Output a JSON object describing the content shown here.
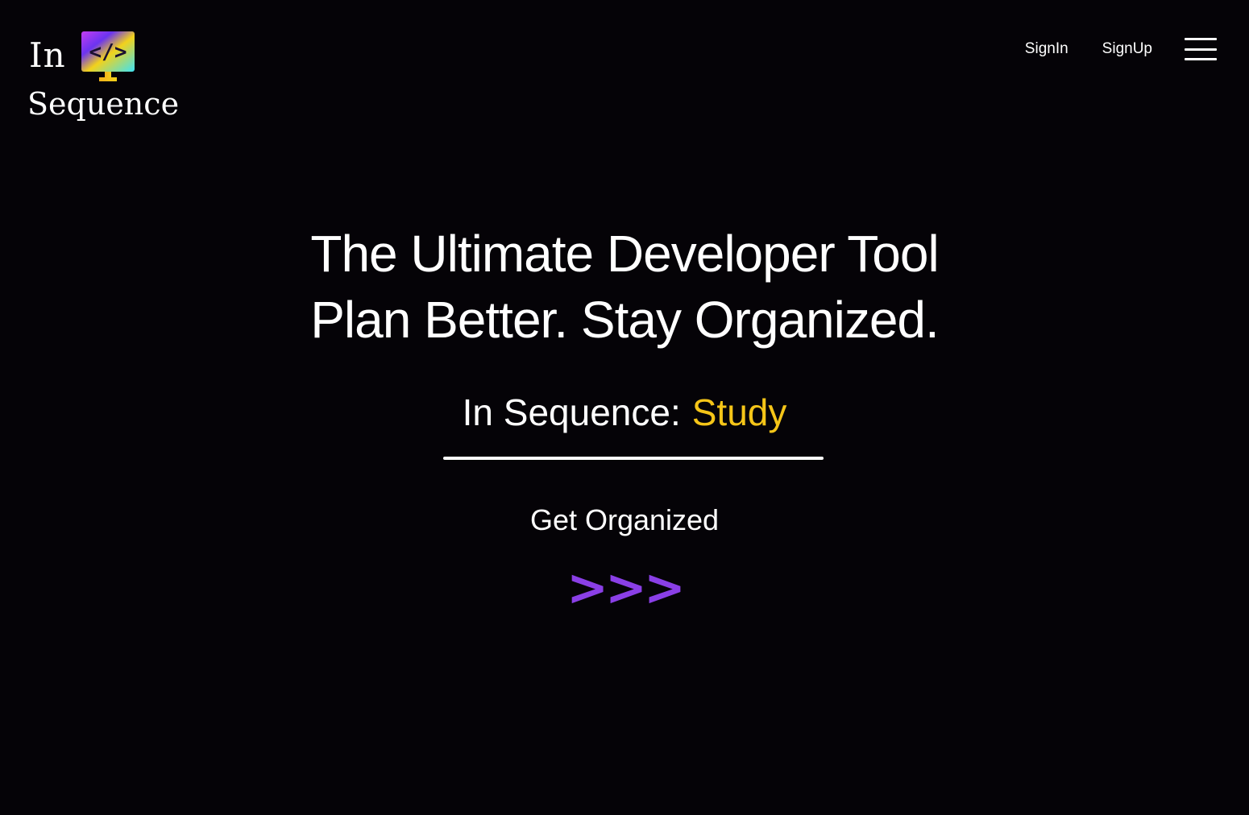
{
  "brand": {
    "word_in": "In",
    "word_sequence": "Sequence",
    "monitor_code_glyph": "</>",
    "gradient_colors": [
      "#3de3f5",
      "#f2d21b",
      "#c43df0",
      "#6b34f0"
    ]
  },
  "nav": {
    "signin_label": "SignIn",
    "signup_label": "SignUp",
    "menu_icon": "hamburger-menu-icon"
  },
  "hero": {
    "title_line_1": "The Ultimate Developer Tool",
    "title_line_2": "Plan Better. Stay Organized."
  },
  "typed": {
    "prefix": "In Sequence:",
    "word": "Study"
  },
  "cta": {
    "label": "Get Organized",
    "arrows": ">>>"
  },
  "colors": {
    "background": "#050307",
    "text": "#ffffff",
    "accent_yellow": "#f5c518",
    "accent_purple": "#8a3fe6"
  }
}
